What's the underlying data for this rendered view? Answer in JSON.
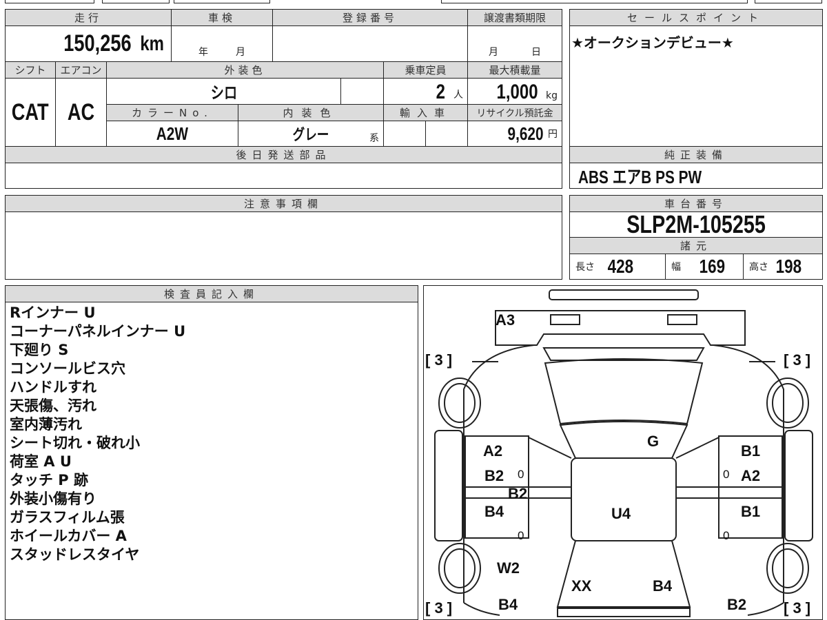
{
  "headers": {
    "mileage": "走行",
    "shaken": "車検",
    "reg_no": "登録番号",
    "transfer_deadline": "譲渡書類期限",
    "shift": "シフト",
    "aircon": "エアコン",
    "ext_color": "外装色",
    "capacity": "乗車定員",
    "max_load": "最大積載量",
    "color_no": "カラーNo.",
    "int_color": "内装色",
    "import": "輸入車",
    "recycle": "リサイクル預託金",
    "later_parts": "後日発送部品",
    "sale_point": "セールスポイント",
    "equipment": "純正装備",
    "caution": "注意事項欄",
    "chassis": "車台番号",
    "specs": "諸元",
    "inspector": "検査員記入欄"
  },
  "values": {
    "mileage": "150,256",
    "mileage_unit": "km",
    "shaken_year": "年",
    "shaken_month": "月",
    "transfer_month": "月",
    "transfer_day": "日",
    "shift": "CAT",
    "aircon": "AC",
    "ext_color": "シロ",
    "capacity": "2",
    "capacity_unit": "人",
    "max_load": "1,000",
    "max_load_unit": "kg",
    "color_no": "A2W",
    "int_color": "グレー",
    "int_color_suffix": "系",
    "recycle": "9,620",
    "recycle_unit": "円",
    "sale_point": "★オークションデビュー★",
    "equipment": "ABS エアB PS PW",
    "chassis": "SLP2M-105255",
    "length_label": "長さ",
    "length": "428",
    "width_label": "幅",
    "width": "169",
    "height_label": "高さ",
    "height": "198"
  },
  "inspector_notes": [
    "Rインナー U",
    "コーナーパネルインナー U",
    "下廻り S",
    "コンソールビス穴",
    "ハンドルすれ",
    "天張傷、汚れ",
    "室内薄汚れ",
    "シート切れ・破れ小",
    "荷室 A U",
    "タッチ P 跡",
    "外装小傷有り",
    "ガラスフィルム張",
    "ホイールカバー A",
    "スタッドレスタイヤ"
  ],
  "diagram": {
    "labels": [
      "A3",
      "G",
      "A2",
      "B1",
      "B2",
      "A2",
      "B2",
      "B4",
      "U4",
      "B1",
      "W2",
      "XX",
      "B4",
      "B4",
      "B2"
    ],
    "zero": "0",
    "tire": "[ 3 ]"
  }
}
